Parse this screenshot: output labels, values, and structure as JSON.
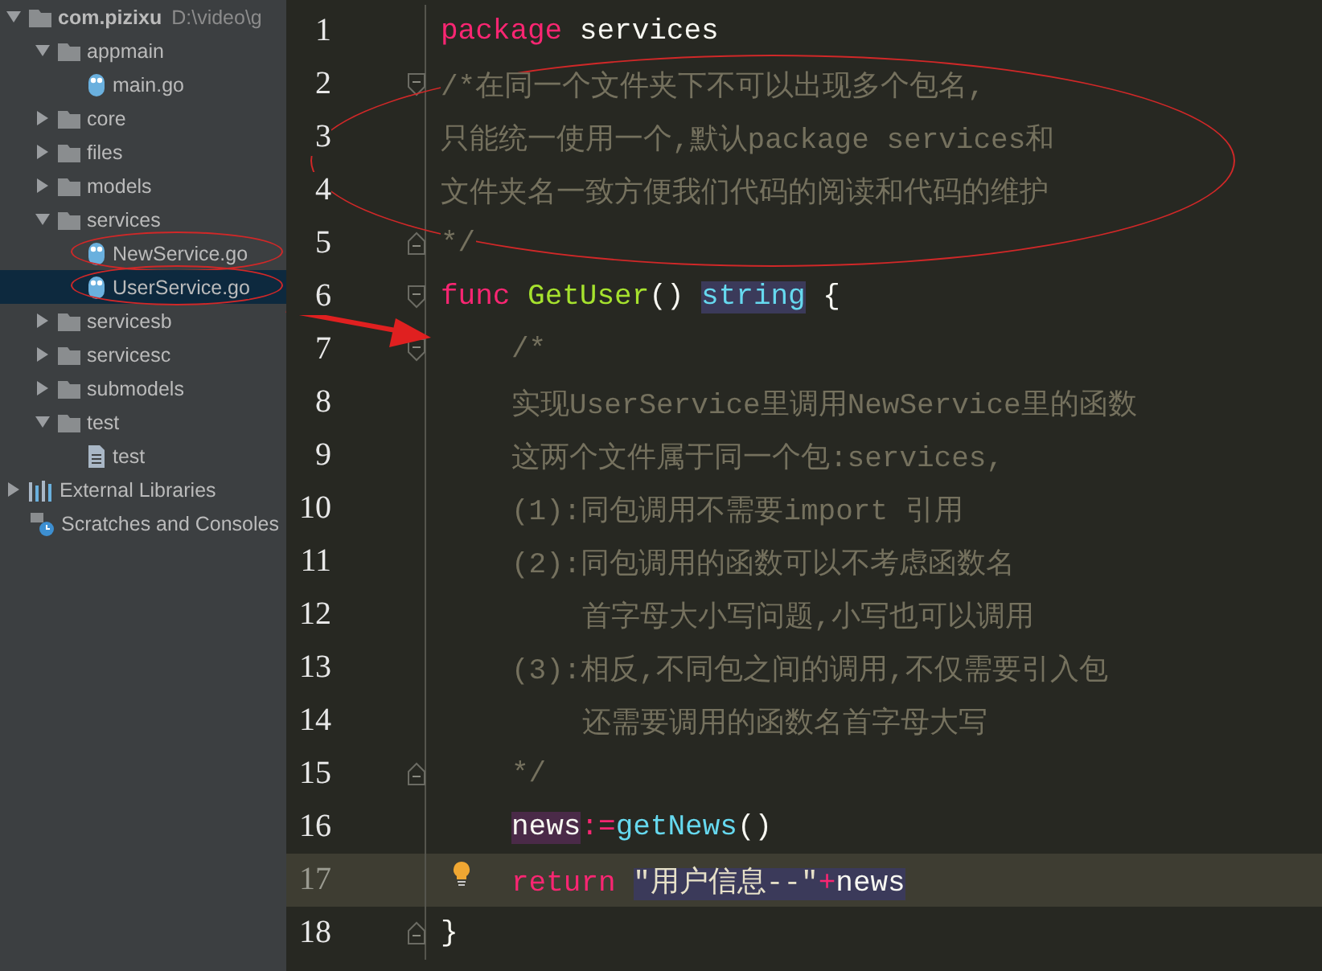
{
  "project_tree": [
    {
      "label": "com.pizixu",
      "path": "D:\\video\\g",
      "kind": "folder",
      "expanded": true,
      "selected": false,
      "circled": false,
      "children": [
        {
          "label": "appmain",
          "kind": "folder",
          "expanded": true,
          "selected": false,
          "circled": false,
          "children": [
            {
              "label": "main.go",
              "kind": "go",
              "selected": false,
              "circled": false
            }
          ]
        },
        {
          "label": "core",
          "kind": "folder",
          "expanded": false,
          "selected": false,
          "circled": false
        },
        {
          "label": "files",
          "kind": "folder",
          "expanded": false,
          "selected": false,
          "circled": false
        },
        {
          "label": "models",
          "kind": "folder",
          "expanded": false,
          "selected": false,
          "circled": false
        },
        {
          "label": "services",
          "kind": "folder",
          "expanded": true,
          "selected": false,
          "circled": false,
          "children": [
            {
              "label": "NewService.go",
              "kind": "go",
              "selected": false,
              "circled": true
            },
            {
              "label": "UserService.go",
              "kind": "go",
              "selected": true,
              "circled": true
            }
          ]
        },
        {
          "label": "servicesb",
          "kind": "folder",
          "expanded": false,
          "selected": false,
          "circled": false
        },
        {
          "label": "servicesc",
          "kind": "folder",
          "expanded": false,
          "selected": false,
          "circled": false
        },
        {
          "label": "submodels",
          "kind": "folder",
          "expanded": false,
          "selected": false,
          "circled": false
        },
        {
          "label": "test",
          "kind": "folder",
          "expanded": true,
          "selected": false,
          "circled": false,
          "children": [
            {
              "label": "test",
              "kind": "file",
              "selected": false,
              "circled": false
            }
          ]
        }
      ]
    },
    {
      "label": "External Libraries",
      "kind": "libraries",
      "expanded": false,
      "selected": false,
      "circled": false
    },
    {
      "label": "Scratches and Consoles",
      "kind": "scratches",
      "selected": false,
      "circled": false
    }
  ],
  "editor": {
    "comment_circled": true,
    "arrow_from_selected": true,
    "lines": [
      {
        "number": "1",
        "kind": "top",
        "current": false,
        "fold_start": false,
        "fold_end": false,
        "bulb": false,
        "tokens": [
          {
            "kind": "keyword",
            "text": "package",
            "highlighted": false
          },
          {
            "kind": "plain",
            "text": " services",
            "highlighted": false
          }
        ]
      },
      {
        "number": "2",
        "kind": "top",
        "current": false,
        "fold_start": true,
        "fold_end": false,
        "bulb": false,
        "tokens": [
          {
            "kind": "comment",
            "text": "/*在同一个文件夹下不可以出现多个包名,",
            "highlighted": false
          }
        ]
      },
      {
        "number": "3",
        "kind": "top",
        "current": false,
        "fold_start": false,
        "fold_end": false,
        "bulb": false,
        "tokens": [
          {
            "kind": "comment",
            "text": "只能统一使用一个,默认package services和",
            "highlighted": false
          }
        ]
      },
      {
        "number": "4",
        "kind": "top",
        "current": false,
        "fold_start": false,
        "fold_end": false,
        "bulb": false,
        "tokens": [
          {
            "kind": "comment",
            "text": "文件夹名一致方便我们代码的阅读和代码的维护",
            "highlighted": false
          }
        ]
      },
      {
        "number": "5",
        "kind": "top",
        "current": false,
        "fold_start": false,
        "fold_end": true,
        "bulb": false,
        "tokens": [
          {
            "kind": "comment",
            "text": "*/",
            "highlighted": false
          }
        ]
      },
      {
        "number": "6",
        "kind": "top",
        "current": false,
        "fold_start": true,
        "fold_end": false,
        "bulb": false,
        "tokens": [
          {
            "kind": "keyword",
            "text": "func ",
            "highlighted": false
          },
          {
            "kind": "function",
            "text": "GetUser",
            "highlighted": false
          },
          {
            "kind": "plain",
            "text": "() ",
            "highlighted": false
          },
          {
            "kind": "type",
            "text": "string",
            "highlighted": true
          },
          {
            "kind": "plain",
            "text": " {",
            "highlighted": false
          }
        ]
      },
      {
        "number": "7",
        "kind": "body",
        "current": false,
        "fold_start": true,
        "fold_end": false,
        "bulb": false,
        "tokens": [
          {
            "kind": "comment",
            "text": "/*",
            "highlighted": false
          }
        ]
      },
      {
        "number": "8",
        "kind": "body",
        "current": false,
        "fold_start": false,
        "fold_end": false,
        "bulb": false,
        "tokens": [
          {
            "kind": "comment",
            "text": "实现UserService里调用NewService里的函数",
            "highlighted": false
          }
        ]
      },
      {
        "number": "9",
        "kind": "body",
        "current": false,
        "fold_start": false,
        "fold_end": false,
        "bulb": false,
        "tokens": [
          {
            "kind": "comment",
            "text": "这两个文件属于同一个包:services,",
            "highlighted": false
          }
        ]
      },
      {
        "number": "10",
        "kind": "body",
        "current": false,
        "fold_start": false,
        "fold_end": false,
        "bulb": false,
        "tokens": [
          {
            "kind": "comment",
            "text": "(1):同包调用不需要import 引用",
            "highlighted": false
          }
        ]
      },
      {
        "number": "11",
        "kind": "body",
        "current": false,
        "fold_start": false,
        "fold_end": false,
        "bulb": false,
        "tokens": [
          {
            "kind": "comment",
            "text": "(2):同包调用的函数可以不考虑函数名",
            "highlighted": false
          }
        ]
      },
      {
        "number": "12",
        "kind": "continuation",
        "current": false,
        "fold_start": false,
        "fold_end": false,
        "bulb": false,
        "tokens": [
          {
            "kind": "comment",
            "text": "首字母大小写问题,小写也可以调用",
            "highlighted": false
          }
        ]
      },
      {
        "number": "13",
        "kind": "body",
        "current": false,
        "fold_start": false,
        "fold_end": false,
        "bulb": false,
        "tokens": [
          {
            "kind": "comment",
            "text": "(3):相反,不同包之间的调用,不仅需要引入包",
            "highlighted": false
          }
        ]
      },
      {
        "number": "14",
        "kind": "continuation",
        "current": false,
        "fold_start": false,
        "fold_end": false,
        "bulb": false,
        "tokens": [
          {
            "kind": "comment",
            "text": "还需要调用的函数名首字母大写",
            "highlighted": false
          }
        ]
      },
      {
        "number": "15",
        "kind": "body",
        "current": false,
        "fold_start": false,
        "fold_end": true,
        "bulb": false,
        "tokens": [
          {
            "kind": "comment",
            "text": "*/",
            "highlighted": false
          }
        ]
      },
      {
        "number": "16",
        "kind": "body",
        "current": false,
        "fold_start": false,
        "fold_end": false,
        "bulb": false,
        "tokens": [
          {
            "kind": "definition",
            "text": "news",
            "highlighted": true
          },
          {
            "kind": "operator",
            "text": ":=",
            "highlighted": false
          },
          {
            "kind": "call",
            "text": "getNews",
            "highlighted": false
          },
          {
            "kind": "plain",
            "text": "()",
            "highlighted": false
          }
        ]
      },
      {
        "number": "17",
        "kind": "body",
        "current": true,
        "fold_start": false,
        "fold_end": false,
        "bulb": true,
        "tokens": [
          {
            "kind": "keyword",
            "text": "return ",
            "highlighted": false
          },
          {
            "kind": "string",
            "text": "\"用户信息--\"",
            "highlighted": true
          },
          {
            "kind": "operator",
            "text": "+",
            "highlighted": true
          },
          {
            "kind": "plain",
            "text": "news",
            "highlighted": true
          }
        ]
      },
      {
        "number": "18",
        "kind": "top",
        "current": false,
        "fold_start": false,
        "fold_end": true,
        "bulb": false,
        "tokens": [
          {
            "kind": "plain",
            "text": "}",
            "highlighted": false
          }
        ]
      }
    ]
  }
}
